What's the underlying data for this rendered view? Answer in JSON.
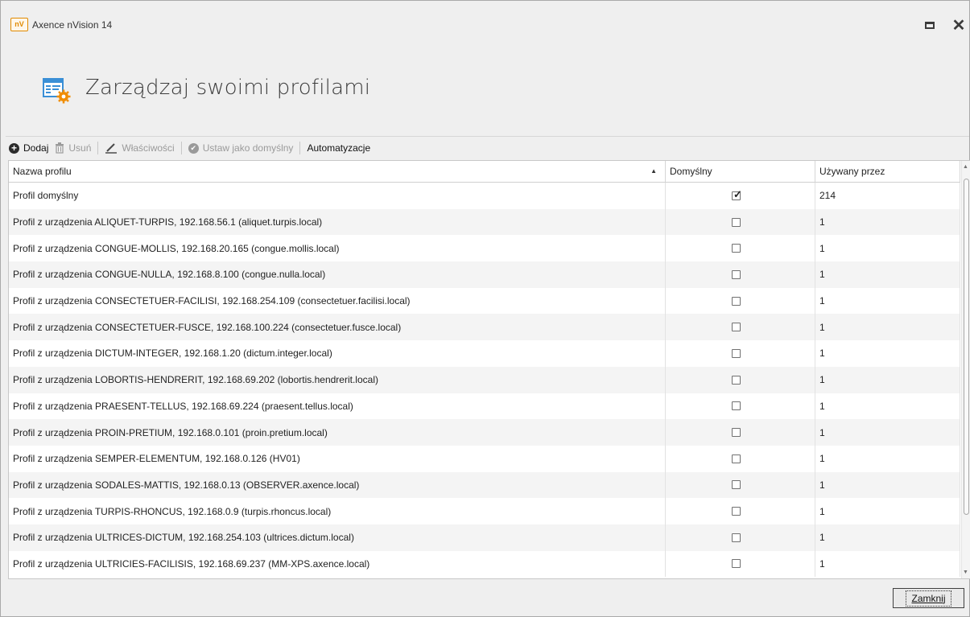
{
  "window": {
    "logo": "nV",
    "title": "Axence nVision 14"
  },
  "header": {
    "title": "Zarządzaj swoimi profilami",
    "icon": "profiles-settings-icon"
  },
  "toolbar": {
    "add_label": "Dodaj",
    "remove_label": "Usuń",
    "properties_label": "Właściwości",
    "set_default_label": "Ustaw jako domyślny",
    "automation_label": "Automatyzacje"
  },
  "grid": {
    "columns": [
      "Nazwa profilu",
      "Domyślny",
      "Używany przez"
    ],
    "sort_indicator": "▲",
    "rows": [
      {
        "name": "Profil domyślny",
        "default": true,
        "used_by": "214"
      },
      {
        "name": "Profil z urządzenia ALIQUET-TURPIS, 192.168.56.1 (aliquet.turpis.local)",
        "default": false,
        "used_by": "1"
      },
      {
        "name": "Profil z urządzenia CONGUE-MOLLIS, 192.168.20.165 (congue.mollis.local)",
        "default": false,
        "used_by": "1"
      },
      {
        "name": "Profil z urządzenia CONGUE-NULLA, 192.168.8.100 (congue.nulla.local)",
        "default": false,
        "used_by": "1"
      },
      {
        "name": "Profil z urządzenia CONSECTETUER-FACILISI, 192.168.254.109 (consectetuer.facilisi.local)",
        "default": false,
        "used_by": "1"
      },
      {
        "name": "Profil z urządzenia CONSECTETUER-FUSCE, 192.168.100.224 (consectetuer.fusce.local)",
        "default": false,
        "used_by": "1"
      },
      {
        "name": "Profil z urządzenia DICTUM-INTEGER, 192.168.1.20 (dictum.integer.local)",
        "default": false,
        "used_by": "1"
      },
      {
        "name": "Profil z urządzenia LOBORTIS-HENDRERIT, 192.168.69.202 (lobortis.hendrerit.local)",
        "default": false,
        "used_by": "1"
      },
      {
        "name": "Profil z urządzenia PRAESENT-TELLUS, 192.168.69.224 (praesent.tellus.local)",
        "default": false,
        "used_by": "1"
      },
      {
        "name": "Profil z urządzenia PROIN-PRETIUM, 192.168.0.101 (proin.pretium.local)",
        "default": false,
        "used_by": "1"
      },
      {
        "name": "Profil z urządzenia SEMPER-ELEMENTUM, 192.168.0.126 (HV01)",
        "default": false,
        "used_by": "1"
      },
      {
        "name": "Profil z urządzenia SODALES-MATTIS, 192.168.0.13 (OBSERVER.axence.local)",
        "default": false,
        "used_by": "1"
      },
      {
        "name": "Profil z urządzenia TURPIS-RHONCUS, 192.168.0.9 (turpis.rhoncus.local)",
        "default": false,
        "used_by": "1"
      },
      {
        "name": "Profil z urządzenia ULTRICES-DICTUM, 192.168.254.103 (ultrices.dictum.local)",
        "default": false,
        "used_by": "1"
      },
      {
        "name": "Profil z urządzenia ULTRICIES-FACILISIS, 192.168.69.237 (MM-XPS.axence.local)",
        "default": false,
        "used_by": "1"
      }
    ]
  },
  "footer": {
    "close_label": "Zamknij"
  },
  "colors": {
    "logo_accent": "#e08a00",
    "window_bg": "#efefef",
    "row_alt": "#f4f4f4"
  }
}
